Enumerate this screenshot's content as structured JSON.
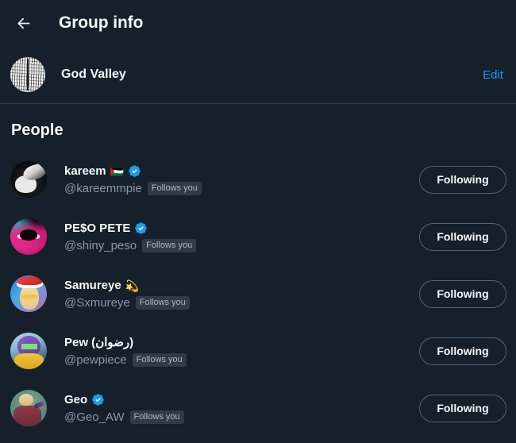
{
  "header": {
    "back_icon": "arrow-left-icon",
    "title": "Group info"
  },
  "group": {
    "name": "God Valley",
    "edit_label": "Edit",
    "avatar_alt": "group-avatar"
  },
  "section": {
    "people_title": "People"
  },
  "colors": {
    "background": "#15202B",
    "accent_blue": "#1D9BF0",
    "divider": "#2F3B47",
    "muted_text": "#8B98A5",
    "badge_bg": "#2F3B47",
    "button_border": "#536471"
  },
  "people": [
    {
      "display_name": "kareem",
      "emoji": "🇵🇸",
      "verified": true,
      "handle": "@kareemmpie",
      "follows_you": "Follows you",
      "action_label": "Following",
      "avatar": "luffy-avatar"
    },
    {
      "display_name": "PE$O PETE",
      "emoji": "",
      "verified": true,
      "handle": "@shiny_peso",
      "follows_you": "Follows you",
      "action_label": "Following",
      "avatar": "peso-avatar"
    },
    {
      "display_name": "Samureye",
      "emoji": "💫",
      "verified": false,
      "handle": "@Sxmureye",
      "follows_you": "Follows you",
      "action_label": "Following",
      "avatar": "samureye-avatar"
    },
    {
      "display_name": "Pew (رضوان)",
      "emoji": "",
      "verified": false,
      "handle": "@pewpiece",
      "follows_you": "Follows you",
      "action_label": "Following",
      "avatar": "pew-avatar"
    },
    {
      "display_name": "Geo",
      "emoji": "",
      "verified": true,
      "handle": "@Geo_AW",
      "follows_you": "Follows you",
      "action_label": "Following",
      "avatar": "geo-avatar"
    }
  ]
}
